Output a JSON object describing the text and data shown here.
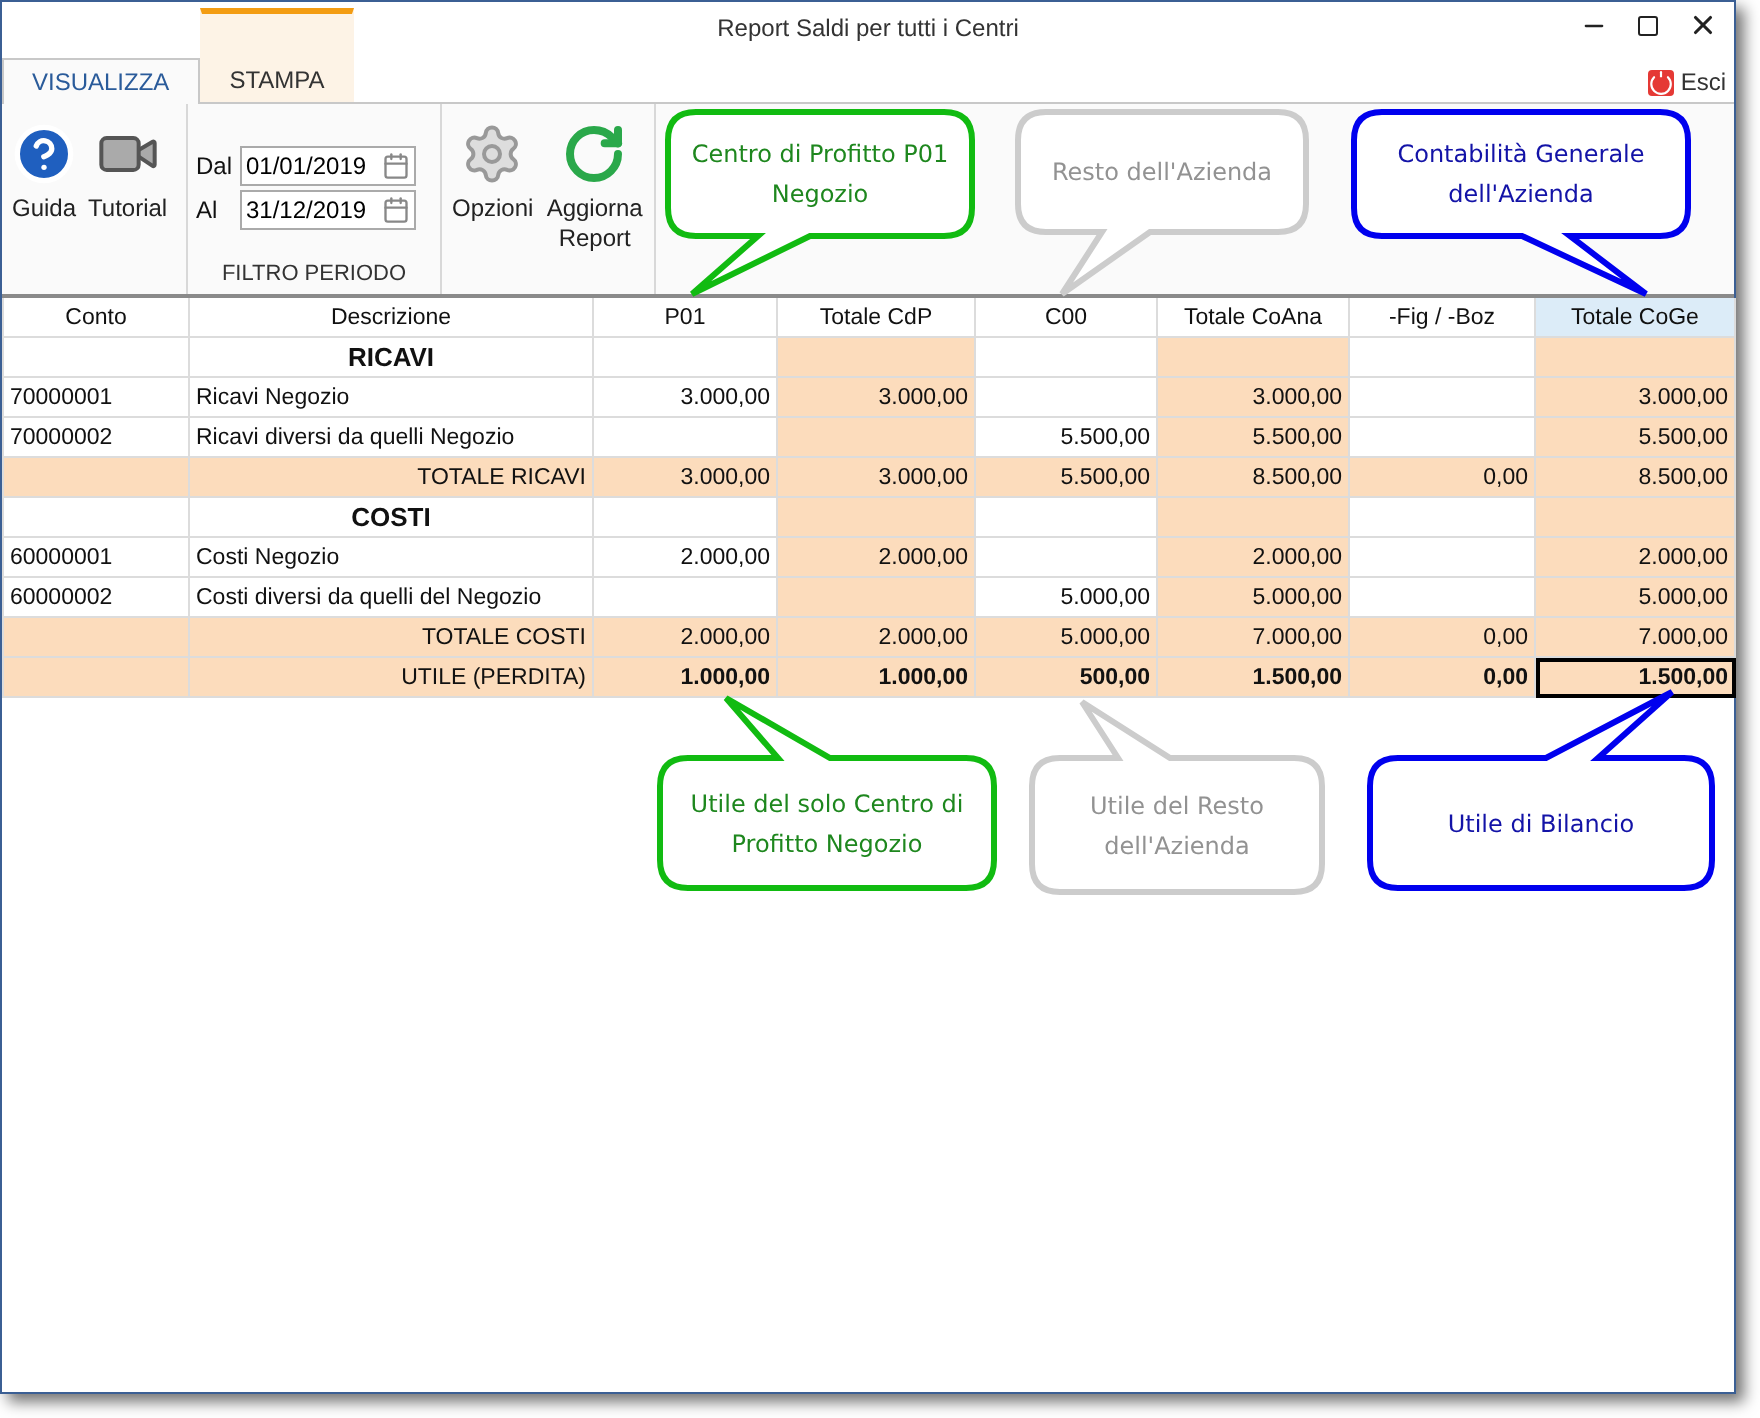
{
  "window": {
    "title": "Report Saldi per tutti i Centri"
  },
  "tabs": [
    {
      "label": "VISUALIZZA",
      "selected": true,
      "accent": false
    },
    {
      "label": "STAMPA",
      "selected": false,
      "accent": true
    }
  ],
  "exit_link": {
    "label": "Esci"
  },
  "ribbon": {
    "help_buttons": [
      {
        "label": "Guida",
        "kind": "help"
      },
      {
        "label": "Tutorial",
        "kind": "video"
      }
    ],
    "period_filter": {
      "group_label": "FILTRO PERIODO",
      "fields": [
        {
          "label": "Dal",
          "value": "01/01/2019"
        },
        {
          "label": "Al",
          "value": "31/12/2019"
        }
      ]
    },
    "action_buttons": [
      {
        "label": "Opzioni",
        "kind": "settings"
      },
      {
        "label": "Aggiorna Report",
        "kind": "refresh"
      }
    ]
  },
  "table": {
    "columns": [
      {
        "label": "Conto",
        "kind": "text",
        "selected": false
      },
      {
        "label": "Descrizione",
        "kind": "text",
        "selected": false
      },
      {
        "label": "P01",
        "kind": "value",
        "selected": false
      },
      {
        "label": "Totale CdP",
        "kind": "total",
        "selected": false
      },
      {
        "label": "C00",
        "kind": "value",
        "selected": false
      },
      {
        "label": "Totale CoAna",
        "kind": "total",
        "selected": false
      },
      {
        "label": "-Fig / -Boz",
        "kind": "value",
        "selected": false
      },
      {
        "label": "Totale CoGe",
        "kind": "total",
        "selected": true
      }
    ],
    "rows": [
      {
        "kind": "section",
        "cells": [
          {
            "selected": false
          },
          {
            "text": "RICAVI",
            "selected": false
          },
          {
            "selected": false
          },
          {
            "selected": false
          },
          {
            "selected": false
          },
          {
            "selected": false
          },
          {
            "selected": false
          },
          {
            "selected": false
          }
        ]
      },
      {
        "kind": "account",
        "cells": [
          {
            "text": "70000001",
            "selected": false
          },
          {
            "text": "Ricavi Negozio",
            "selected": false
          },
          {
            "text": "3.000,00",
            "selected": false
          },
          {
            "text": "3.000,00",
            "selected": false
          },
          {
            "selected": false
          },
          {
            "text": "3.000,00",
            "selected": false
          },
          {
            "selected": false
          },
          {
            "text": "3.000,00",
            "selected": false
          }
        ]
      },
      {
        "kind": "account",
        "cells": [
          {
            "text": "70000002",
            "selected": false
          },
          {
            "text": "Ricavi diversi da quelli Negozio",
            "selected": false
          },
          {
            "selected": false
          },
          {
            "selected": false
          },
          {
            "text": "5.500,00",
            "selected": false
          },
          {
            "text": "5.500,00",
            "selected": false
          },
          {
            "selected": false
          },
          {
            "text": "5.500,00",
            "selected": false
          }
        ]
      },
      {
        "kind": "total",
        "cells": [
          {
            "selected": false
          },
          {
            "text": "TOTALE RICAVI",
            "selected": false
          },
          {
            "text": "3.000,00",
            "selected": false
          },
          {
            "text": "3.000,00",
            "selected": false
          },
          {
            "text": "5.500,00",
            "selected": false
          },
          {
            "text": "8.500,00",
            "selected": false
          },
          {
            "text": "0,00",
            "selected": false
          },
          {
            "text": "8.500,00",
            "selected": false
          }
        ]
      },
      {
        "kind": "section",
        "cells": [
          {
            "selected": false
          },
          {
            "text": "COSTI",
            "selected": false
          },
          {
            "selected": false
          },
          {
            "selected": false
          },
          {
            "selected": false
          },
          {
            "selected": false
          },
          {
            "selected": false
          },
          {
            "selected": false
          }
        ]
      },
      {
        "kind": "account",
        "cells": [
          {
            "text": "60000001",
            "selected": false
          },
          {
            "text": "Costi Negozio",
            "selected": false
          },
          {
            "text": "2.000,00",
            "selected": false
          },
          {
            "text": "2.000,00",
            "selected": false
          },
          {
            "selected": false
          },
          {
            "text": "2.000,00",
            "selected": false
          },
          {
            "selected": false
          },
          {
            "text": "2.000,00",
            "selected": false
          }
        ]
      },
      {
        "kind": "account",
        "cells": [
          {
            "text": "60000002",
            "selected": false
          },
          {
            "text": "Costi diversi da quelli del Negozio",
            "selected": false
          },
          {
            "selected": false
          },
          {
            "selected": false
          },
          {
            "text": "5.000,00",
            "selected": false
          },
          {
            "text": "5.000,00",
            "selected": false
          },
          {
            "selected": false
          },
          {
            "text": "5.000,00",
            "selected": false
          }
        ]
      },
      {
        "kind": "total",
        "cells": [
          {
            "selected": false
          },
          {
            "text": "TOTALE COSTI",
            "selected": false
          },
          {
            "text": "2.000,00",
            "selected": false
          },
          {
            "text": "2.000,00",
            "selected": false
          },
          {
            "text": "5.000,00",
            "selected": false
          },
          {
            "text": "7.000,00",
            "selected": false
          },
          {
            "text": "0,00",
            "selected": false
          },
          {
            "text": "7.000,00",
            "selected": false
          }
        ]
      },
      {
        "kind": "result",
        "cells": [
          {
            "selected": false
          },
          {
            "text": "UTILE (PERDITA)",
            "selected": false
          },
          {
            "text": "1.000,00",
            "selected": false
          },
          {
            "text": "1.000,00",
            "selected": false
          },
          {
            "text": "500,00",
            "selected": false
          },
          {
            "text": "1.500,00",
            "selected": false
          },
          {
            "text": "0,00",
            "selected": false
          },
          {
            "text": "1.500,00",
            "selected": true
          }
        ]
      }
    ]
  },
  "callouts": [
    {
      "text": "Centro di Profitto P01 Negozio",
      "color": "#11bb11"
    },
    {
      "text": "Resto dell'Azienda",
      "color": "#cccccc"
    },
    {
      "text": "Contabilità Generale dell'Azienda",
      "color": "#0000ee"
    },
    {
      "text": "Utile del solo Centro di Profitto Negozio",
      "color": "#11bb11"
    },
    {
      "text": "Utile del Resto dell'Azienda",
      "color": "#cccccc"
    },
    {
      "text": "Utile di Bilancio",
      "color": "#0000ee"
    }
  ]
}
